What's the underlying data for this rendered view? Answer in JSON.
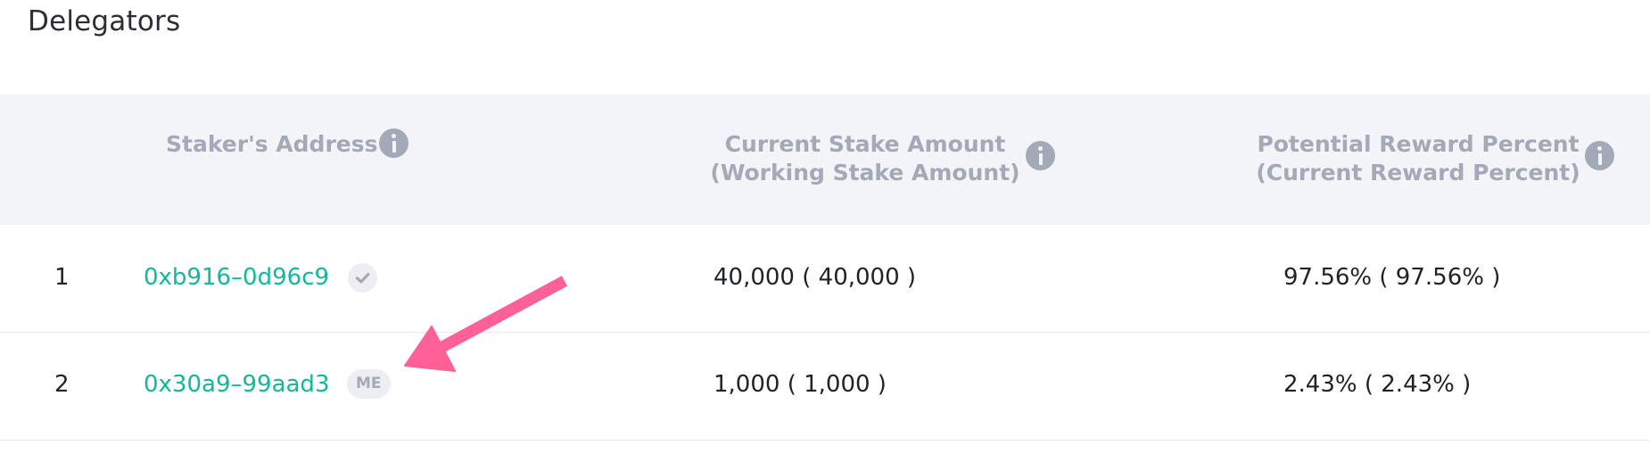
{
  "page": {
    "title": "Delegators"
  },
  "table": {
    "columns": {
      "address": "Staker's Address",
      "stake_line1": "Current Stake Amount",
      "stake_line2": "(Working Stake Amount)",
      "reward_line1": "Potential Reward Percent",
      "reward_line2": "(Current Reward Percent)"
    },
    "rows": [
      {
        "index": "1",
        "address": "0xb916–0d96c9",
        "badge": "check-icon",
        "stake": "40,000 ( 40,000 )",
        "reward": "97.56% ( 97.56% )"
      },
      {
        "index": "2",
        "address": "0x30a9–99aad3",
        "badge": "ME",
        "stake": "1,000 ( 1,000 )",
        "reward": "2.43% ( 2.43% )"
      }
    ]
  },
  "colors": {
    "address_link": "#12b89a",
    "header_bg": "#f3f4f8",
    "header_text": "#a3a9b6",
    "annotation_arrow": "#ff6196"
  },
  "icons": [
    "info-icon",
    "check-icon",
    "annotation-arrow"
  ]
}
